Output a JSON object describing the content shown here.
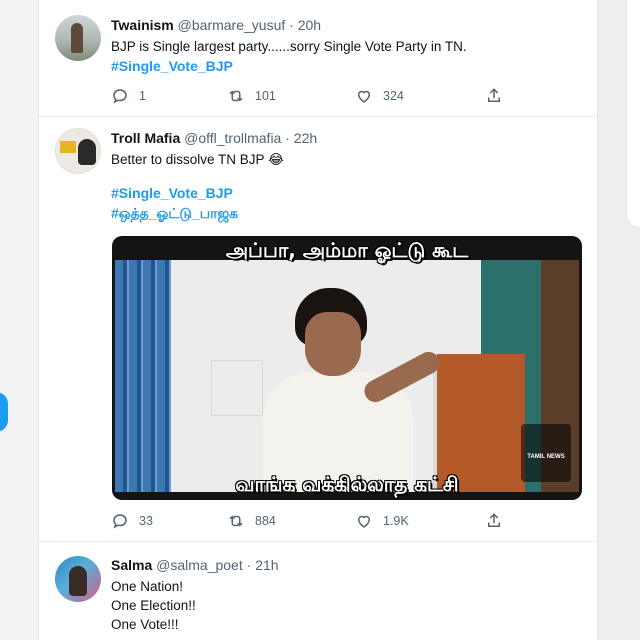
{
  "tweets": [
    {
      "name": "Twainism",
      "handle": "@barmare_yusuf",
      "time": "20h",
      "text": "BJP is Single largest party......sorry Single Vote Party in TN.",
      "tags": [
        "#Single_Vote_BJP"
      ],
      "replies": "1",
      "retweets": "101",
      "likes": "324"
    },
    {
      "name": "Troll Mafia",
      "handle": "@offl_trollmafia",
      "time": "22h",
      "text": "Better to dissolve TN BJP 😂",
      "tags": [
        "#Single_Vote_BJP",
        "#ஒத்த_ஓட்டு_பாஜக"
      ],
      "meme_top": "அப்பா, அம்மா ஓட்டு கூட",
      "meme_bottom": "வாங்க வக்கில்லாத கட்சி",
      "media_logo": "TAMIL NEWS",
      "replies": "33",
      "retweets": "884",
      "likes": "1.9K"
    },
    {
      "name": "Salma",
      "handle": "@salma_poet",
      "time": "21h",
      "lines": [
        "One Nation!",
        "One Election!!",
        "One Vote!!!"
      ]
    }
  ],
  "separator": "·",
  "colors": {
    "accent": "#1d9bf0",
    "secondary_text": "#536471"
  },
  "icons": [
    "reply-icon",
    "retweet-icon",
    "like-icon",
    "share-icon"
  ]
}
